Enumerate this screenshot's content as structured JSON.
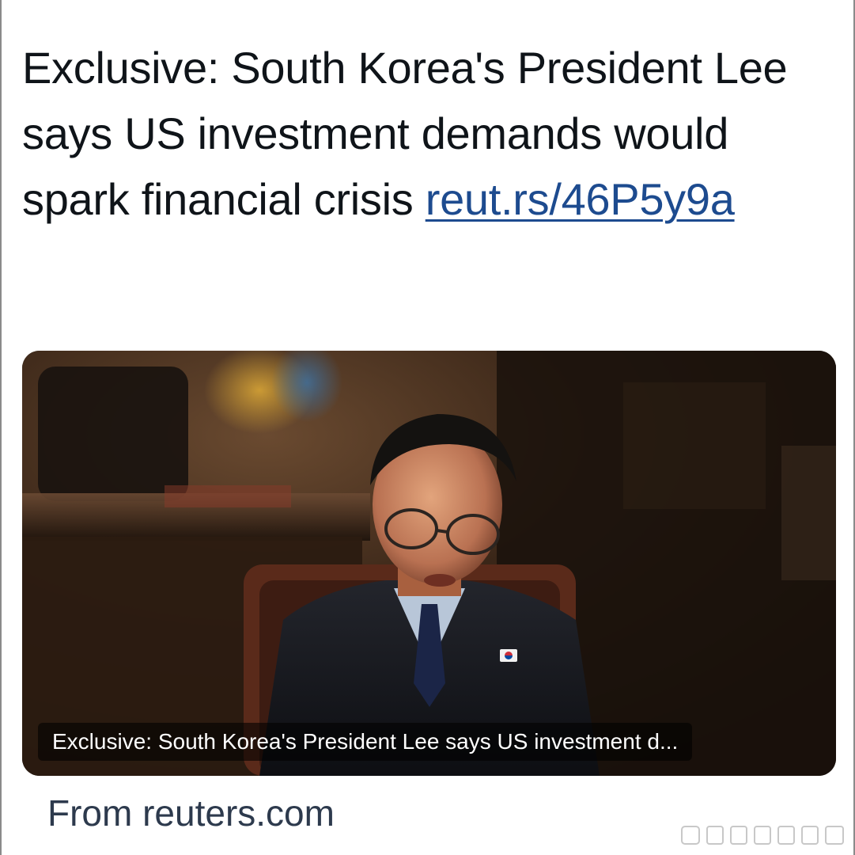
{
  "post": {
    "text": "Exclusive: South Korea's President Lee says US investment demands would spark financial crisis ",
    "link_text": "reut.rs/46P5y9a"
  },
  "card": {
    "caption": "Exclusive: South Korea's President Lee says US investment d...",
    "image_subject": "President Lee seated in an office during an interview, wearing glasses and a dark suit with a South Korean flag lapel pin"
  },
  "source": {
    "prefix": "From ",
    "domain": "reuters.com"
  },
  "icons": {
    "lapel_pin": "south-korea-flag-icon",
    "watermark": "watermark-logo"
  },
  "colors": {
    "text": "#0f1419",
    "link": "#1d4b8f",
    "source_text": "#2d3a4d",
    "caption_bg": "rgba(0,0,0,0.58)"
  }
}
